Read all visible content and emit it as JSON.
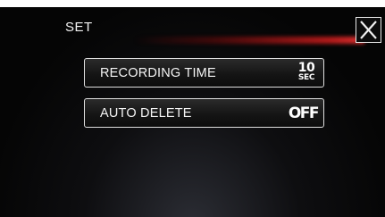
{
  "header": {
    "title": "SET",
    "close_icon": "close-x-icon"
  },
  "menu": {
    "items": [
      {
        "label": "RECORDING TIME",
        "value_number": "10",
        "value_unit": "SEC"
      },
      {
        "label": "AUTO DELETE",
        "value": "OFF"
      }
    ]
  },
  "colors": {
    "background": "#050505",
    "accent_line": "#d21e1e",
    "button_border": "#e0e0e0",
    "text": "#f4f4f4"
  }
}
